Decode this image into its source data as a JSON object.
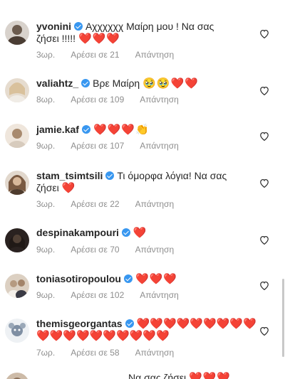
{
  "comments": [
    {
      "username": "yvonini",
      "verified": true,
      "text": "Αχχχχχχ Μαίρη μου ! Να σας",
      "text_line2": "ζήσει !!!!!",
      "hearts_line1": "",
      "hearts_line2": "❤️❤️❤️",
      "time": "3ωρ.",
      "likes": "Αρέσει σε 21",
      "reply": "Απάντηση",
      "avatar_color": "#6b5b4e"
    },
    {
      "username": "valiahtz_",
      "verified": true,
      "text": "Βρε Μαίρη",
      "hearts_line1": "🥹🥹❤️❤️",
      "time": "8ωρ.",
      "likes": "Αρέσει σε 109",
      "reply": "Απάντηση",
      "avatar_color": "#c9a98a"
    },
    {
      "username": "jamie.kaf",
      "verified": true,
      "text": "",
      "hearts_line1": "❤️❤️❤️👏",
      "time": "9ωρ.",
      "likes": "Αρέσει σε 107",
      "reply": "Απάντηση",
      "avatar_color": "#a88a6e"
    },
    {
      "username": "stam_tsimtsili",
      "verified": true,
      "text": "Τι όμορφα λόγια! Να σας",
      "text_line2": "ζήσει",
      "hearts_line1": "",
      "hearts_line2": "❤️",
      "time": "3ωρ.",
      "likes": "Αρέσει σε 22",
      "reply": "Απάντηση",
      "avatar_color": "#8a6a52"
    },
    {
      "username": "despinakampouri",
      "verified": true,
      "text": "",
      "hearts_line1": "❤️",
      "time": "9ωρ.",
      "likes": "Αρέσει σε 70",
      "reply": "Απάντηση",
      "avatar_color": "#3a2e2a"
    },
    {
      "username": "toniasotiropoulou",
      "verified": true,
      "text": "",
      "hearts_line1": "❤️❤️❤️",
      "time": "9ωρ.",
      "likes": "Αρέσει σε 102",
      "reply": "Απάντηση",
      "avatar_color": "#b59a80"
    },
    {
      "username": "themisgeorgantas",
      "verified": true,
      "text": "",
      "hearts_line1": "❤️❤️❤️❤️❤️❤️❤️❤️❤️",
      "hearts_line2": "❤️❤️❤️❤️❤️❤️❤️❤️❤️❤️",
      "time": "7ωρ.",
      "likes": "Αρέσει σε 58",
      "reply": "Απάντηση",
      "avatar_color": "#7f8fa3"
    }
  ],
  "partial_comment": {
    "text": "Να σας ζήσει",
    "hearts": "❤️❤️❤️"
  },
  "colors": {
    "text": "#262626",
    "meta": "#8e8e8e",
    "verified": "#3897f0",
    "heart": "#e0152b"
  }
}
